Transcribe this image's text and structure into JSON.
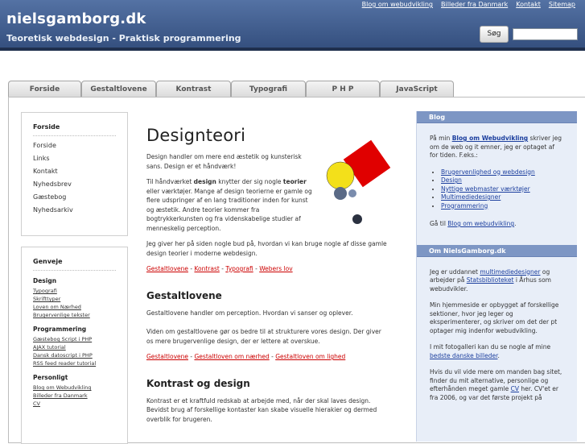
{
  "header": {
    "site_title": "nielsgamborg.dk",
    "tagline": "Teoretisk webdesign - Praktisk programmering",
    "search_button": "Søg",
    "top_links": [
      "Blog om webudvikling",
      "Billeder fra Danmark",
      "Kontakt",
      "Sitemap"
    ]
  },
  "tabs": [
    "Forside",
    "Gestaltlovene",
    "Kontrast",
    "Typografi",
    "P H P",
    "JavaScript"
  ],
  "nav_box": {
    "title": "Forside",
    "items": [
      "Forside",
      "Links",
      "Kontakt",
      "Nyhedsbrev",
      "Gæstebog",
      "Nyhedsarkiv"
    ]
  },
  "shortcut_box": {
    "title": "Genveje",
    "design": {
      "title": "Design",
      "items": [
        "Typografi",
        "Skrifttyper",
        "Loven om Nærhed",
        "Brugervenlige tekster"
      ]
    },
    "programming": {
      "title": "Programmering",
      "items": [
        "Gæstebog Script i PHP",
        "AJAX tutorial",
        "Dansk datoscript i PHP",
        "RSS feed reader tutorial"
      ]
    },
    "personal": {
      "title": "Personligt",
      "items": [
        "Blog om Webudvikling",
        "Billeder fra Danmark",
        "CV"
      ]
    }
  },
  "main": {
    "heading": "Designteori",
    "intro": "Design handler om mere end æstetik og kunsterisk sans. Design er et håndværk!",
    "para2_pre": "Til håndværket ",
    "para2_b1": "design",
    "para2_mid": " knytter der sig nogle ",
    "para2_b2": "teorier",
    "para2_post": " eller værktøjer. Mange af design teorierne er gamle og flere udspringer af en lang traditioner inden for kunst og æstetik. Andre teorier kommer fra bogtrykkerkunsten og fra videnskabelige studier af menneskelig perception.",
    "para3": "Jeg giver her på siden nogle bud på, hvordan vi kan bruge nogle af disse gamle design teorier i moderne webdesign.",
    "links1": [
      "Gestaltlovene",
      "Kontrast",
      "Typografi",
      "Webers lov"
    ],
    "sep": " - ",
    "gestalt_heading": "Gestaltlovene",
    "gestalt_p1": "Gestaltlovene handler om perception. Hvordan vi sanser og oplever.",
    "gestalt_p2": "Viden om gestaltlovene gør os bedre til at strukturere vores design. Der giver os mere brugervenlige design, der er lettere at overskue.",
    "links2": [
      "Gestaltlovene",
      "Gestaltloven om nærhed",
      "Gestaltloven om lighed"
    ],
    "kontrast_heading": "Kontrast og design",
    "kontrast_p": "Kontrast er et kraftfuld redskab at arbejde med, når der skal laves design. Bevidst brug af forskellige kontaster kan skabe visuelle hierakier og dermed overblik for brugeren."
  },
  "sidebar": {
    "blog": {
      "title": "Blog",
      "p1_pre": "På min ",
      "p1_link": "Blog om Webudvikling",
      "p1_post": " skriver jeg om de web og it emner, jeg er optaget af for tiden. F.eks.:",
      "items": [
        "Brugervenlighed og webdesign",
        "Design",
        "Nyttige webmaster værktøjer",
        "Multimediedesigner",
        "Programmering"
      ],
      "p2_pre": "Gå til ",
      "p2_link": "Blog om webudvikling",
      "p2_post": "."
    },
    "about": {
      "title": "Om NielsGamborg.dk",
      "p1_pre": "Jeg er uddannet ",
      "p1_link1": "multimediedesigner",
      "p1_mid": " og arbejder på ",
      "p1_link2": "Statsbiblioteket",
      "p1_post": " i Århus som webudvikler.",
      "p2": "Min hjemmeside er opbygget af forskellige sektioner, hvor jeg leger og eksperimenterer, og skriver om det der pt optager mig indenfor webudvikling.",
      "p3_pre": "I mit fotogalleri kan du se nogle af mine ",
      "p3_link": "bedste danske billeder",
      "p3_post": ".",
      "p4_pre": "Hvis du vil vide mere om manden bag sitet, finder du mit alternative, personlige og efterhånden meget gamle ",
      "p4_link": "CV",
      "p4_post": " her. CV'et er fra 2006, og var det første projekt på"
    }
  },
  "colors": {
    "header": "#40598a",
    "link_red": "#cc0000",
    "sidebar_bg": "#e8eef8",
    "sidebar_head": "#7d96c4",
    "square": "#e00000",
    "circle": "#f3e01a",
    "dot": "#5a6a86"
  }
}
